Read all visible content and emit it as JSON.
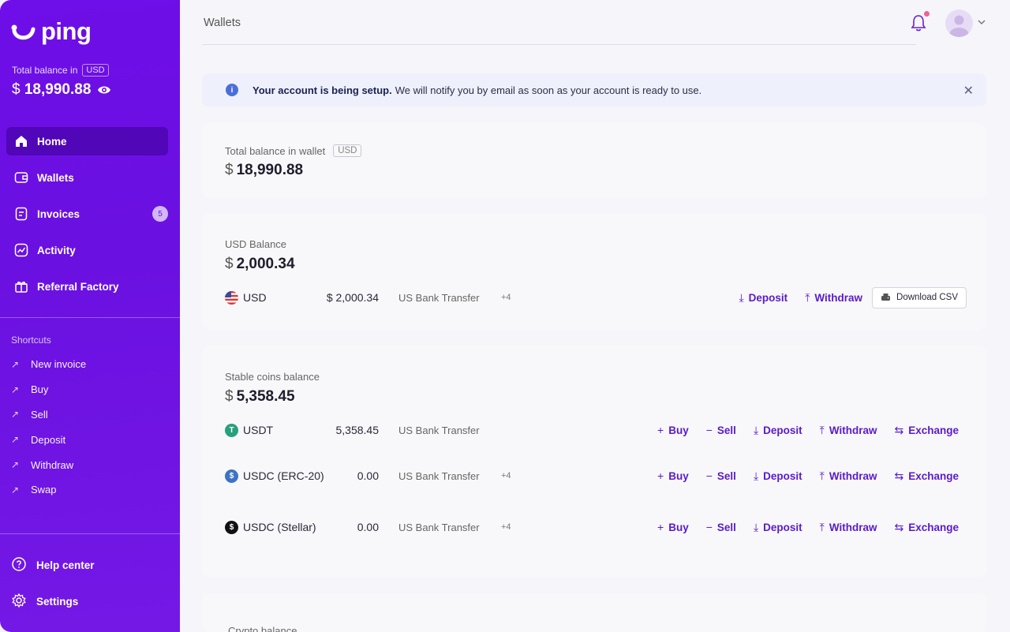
{
  "brand": {
    "name": "ping"
  },
  "sidebar": {
    "total_label": "Total balance in",
    "total_currency": "USD",
    "total_dollar": "$",
    "total_value": "18,990.88",
    "nav": [
      {
        "label": "Home",
        "icon": "home-icon",
        "active": true
      },
      {
        "label": "Wallets",
        "icon": "wallet-icon"
      },
      {
        "label": "Invoices",
        "icon": "invoice-icon",
        "badge": "5"
      },
      {
        "label": "Activity",
        "icon": "activity-icon"
      },
      {
        "label": "Referral Factory",
        "icon": "gift-icon"
      }
    ],
    "shortcuts_title": "Shortcuts",
    "shortcuts": [
      "New invoice",
      "Buy",
      "Sell",
      "Deposit",
      "Withdraw",
      "Swap"
    ],
    "bottom": [
      {
        "label": "Help center",
        "icon": "help-icon"
      },
      {
        "label": "Settings",
        "icon": "gear-icon"
      }
    ]
  },
  "header": {
    "title": "Wallets"
  },
  "alert": {
    "bold": "Your account is being setup.",
    "text": "We will notify you by email as soon as your account is ready to use."
  },
  "wallet_total": {
    "label": "Total balance in wallet",
    "currency": "USD",
    "dollar": "$",
    "value": "18,990.88"
  },
  "usd_balance": {
    "label": "USD Balance",
    "dollar": "$",
    "value": "2,000.34",
    "row": {
      "asset": "USD",
      "amount": "$ 2,000.34",
      "method": "US Bank Transfer",
      "more": "+4",
      "actions": [
        "Deposit",
        "Withdraw"
      ],
      "csv": "Download CSV"
    }
  },
  "stable_balance": {
    "label": "Stable coins balance",
    "dollar": "$",
    "value": "5,358.45",
    "rows": [
      {
        "asset": "USDT",
        "amount": "5,358.45",
        "method": "US Bank Transfer",
        "more": ""
      },
      {
        "asset": "USDC (ERC-20)",
        "amount": "0.00",
        "method": "US Bank Transfer",
        "more": "+4"
      },
      {
        "asset": "USDC (Stellar)",
        "amount": "0.00",
        "method": "US Bank Transfer",
        "more": "+4"
      }
    ],
    "actions": [
      "Buy",
      "Sell",
      "Deposit",
      "Withdraw",
      "Exchange"
    ]
  },
  "crypto_balance": {
    "label": "Crypto balance"
  },
  "colors": {
    "sidebar": "#6e0ee8",
    "accent": "#5a1ac9",
    "alert_bg": "#eef0fb",
    "bell_dot": "#f06292"
  }
}
